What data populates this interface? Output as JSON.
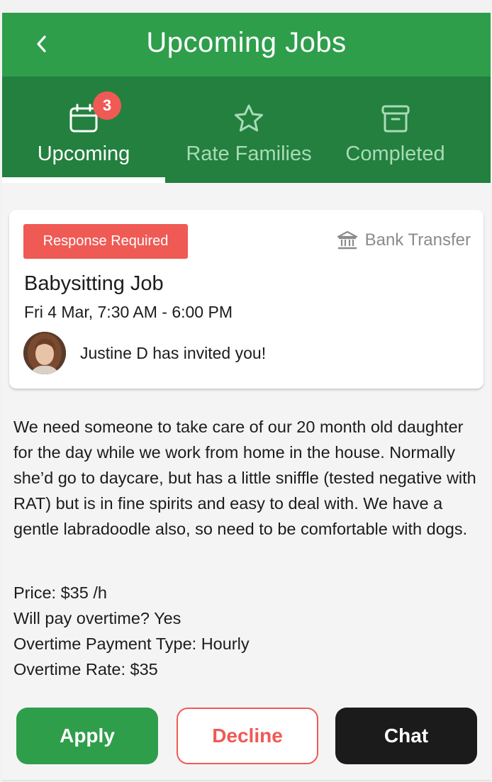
{
  "header": {
    "title": "Upcoming Jobs",
    "back_icon": "chevron-left-icon"
  },
  "tabs": [
    {
      "label": "Upcoming",
      "icon": "calendar-icon",
      "active": true,
      "badge": "3"
    },
    {
      "label": "Rate Families",
      "icon": "star-icon",
      "active": false
    },
    {
      "label": "Completed",
      "icon": "archive-icon",
      "active": false
    }
  ],
  "job_card": {
    "status_tag": "Response Required",
    "payment_method": "Bank Transfer",
    "payment_icon": "bank-icon",
    "title": "Babysitting Job",
    "time": "Fri 4 Mar, 7:30 AM - 6:00 PM",
    "invite_text": "Justine D has invited you!"
  },
  "description": "We need someone to take care of our 20 month old daughter for the day while we work from home in the house. Normally she’d go to daycare, but has a little sniffle (tested negative with RAT) but is in fine spirits and easy to deal with. We have a gentle labradoodle also, so need to be comfortable with dogs.",
  "details": {
    "price": "Price: $35 /h",
    "overtime": "Will pay overtime? Yes",
    "overtime_type": "Overtime Payment Type: Hourly",
    "overtime_rate": "Overtime Rate: $35"
  },
  "actions": {
    "apply": "Apply",
    "decline": "Decline",
    "chat": "Chat"
  },
  "colors": {
    "header_green": "#2e9e4b",
    "tab_bar_green": "#23803f",
    "accent_red": "#ef5a55",
    "chat_black": "#1b1b1b"
  }
}
